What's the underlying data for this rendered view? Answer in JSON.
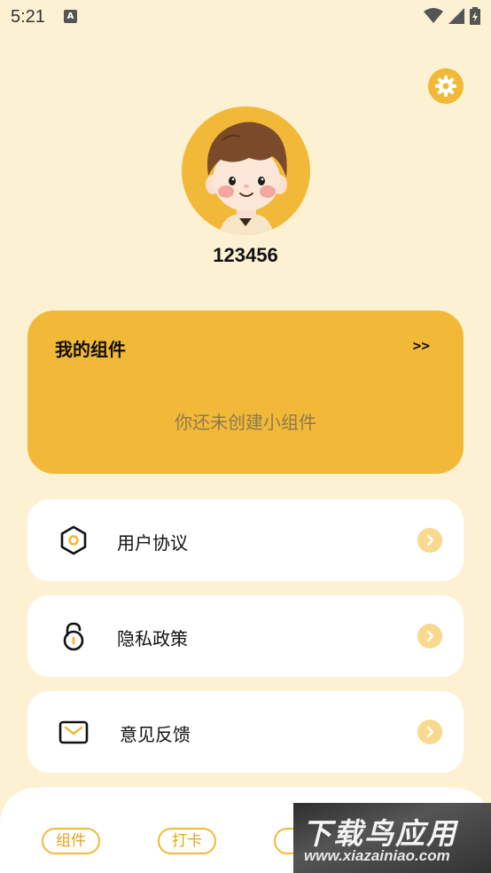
{
  "status_bar": {
    "time": "5:21",
    "notif_letter": "A"
  },
  "profile": {
    "username": "123456"
  },
  "widget": {
    "title": "我的组件",
    "more": ">>",
    "empty": "你还未创建小组件"
  },
  "menu": [
    {
      "label": "用户协议",
      "icon": "hexagon-icon"
    },
    {
      "label": "隐私政策",
      "icon": "lock-icon"
    },
    {
      "label": "意见反馈",
      "icon": "mail-icon"
    }
  ],
  "tabs": [
    {
      "label": "组件"
    },
    {
      "label": "打卡"
    }
  ],
  "watermark": {
    "top": "下载鸟应用",
    "bottom": "www.xiazainiao.com"
  },
  "colors": {
    "background": "#fdf1d4",
    "accent": "#f2b837",
    "arrow": "#f9d88f"
  }
}
